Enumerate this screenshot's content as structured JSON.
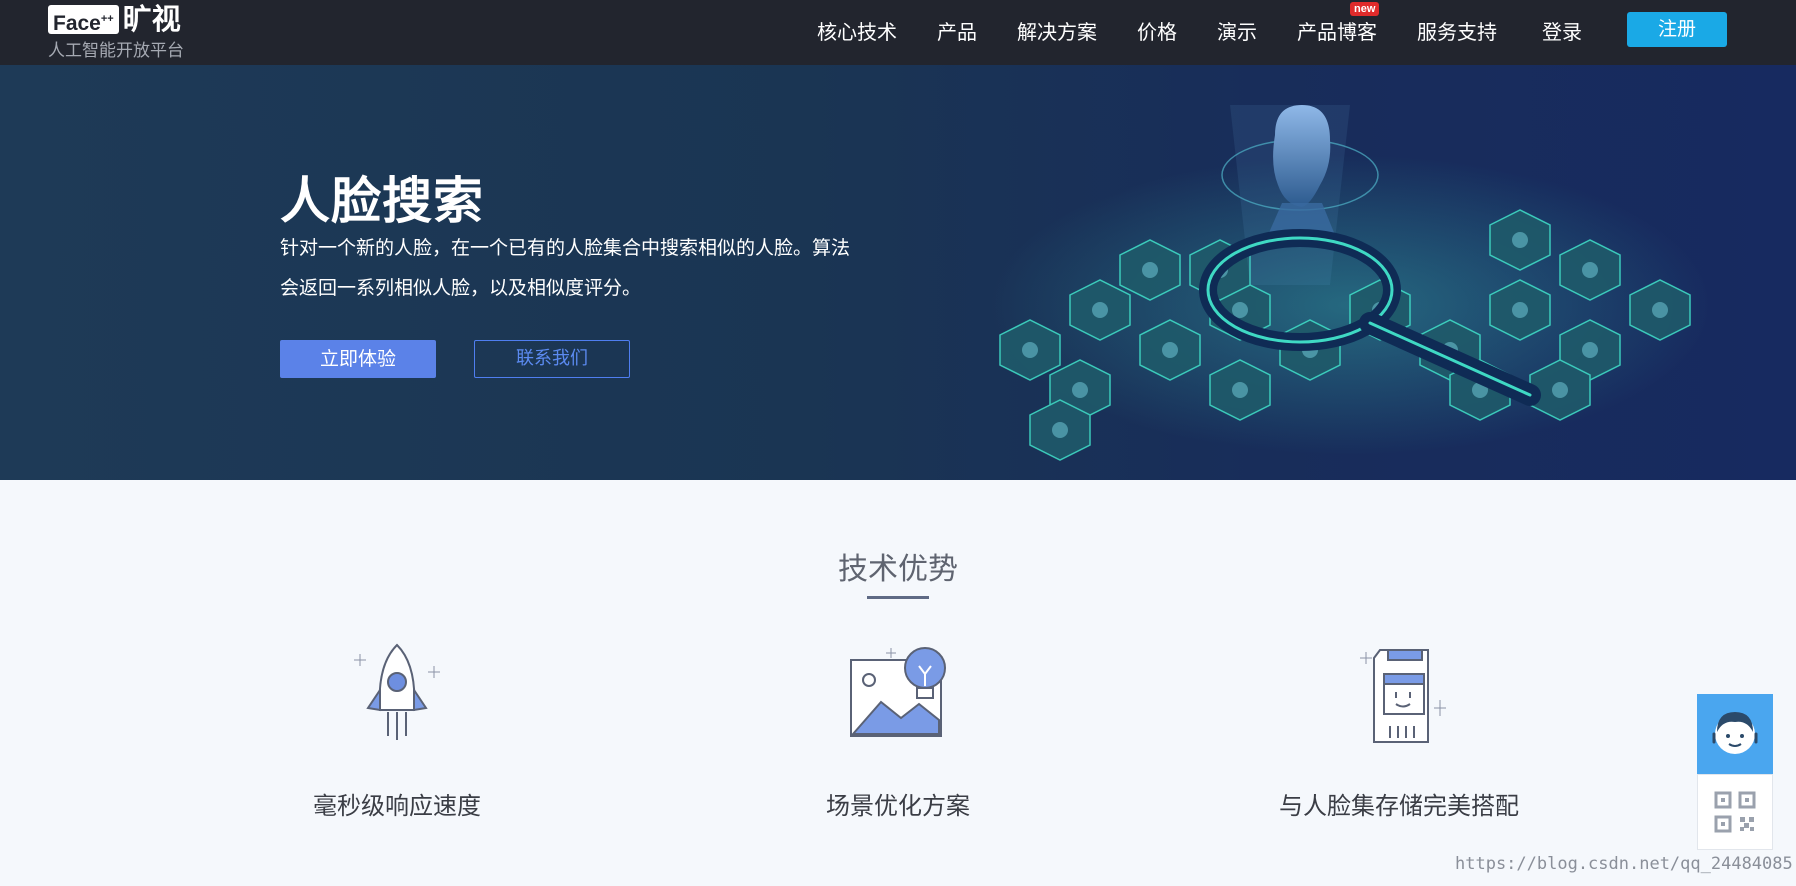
{
  "nav": {
    "logo": {
      "face": "Face",
      "sup": "++",
      "cn": "旷视",
      "subtitle": "人工智能开放平台"
    },
    "items": [
      {
        "label": "核心技术"
      },
      {
        "label": "产品"
      },
      {
        "label": "解决方案"
      },
      {
        "label": "价格"
      },
      {
        "label": "演示"
      },
      {
        "label": "产品博客",
        "badge": "new"
      },
      {
        "label": "服务支持"
      },
      {
        "label": "登录"
      }
    ],
    "register_label": "注册"
  },
  "hero": {
    "title": "人脸搜索",
    "desc_line1": "针对一个新的人脸，在一个已有的人脸集合中搜索相似的人脸。算法",
    "desc_line2": "会返回一系列相似人脸，以及相似度评分。",
    "primary_button": "立即体验",
    "secondary_button": "联系我们"
  },
  "advantages": {
    "title": "技术优势",
    "items": [
      {
        "label": "毫秒级响应速度",
        "icon": "rocket-icon"
      },
      {
        "label": "场景优化方案",
        "icon": "scene-lightbulb-icon"
      },
      {
        "label": "与人脸集存储完美搭配",
        "icon": "storage-card-icon"
      }
    ]
  },
  "floating": {
    "top_icon": "customer-service-icon",
    "bottom_icon": "qr-code-icon"
  },
  "watermark": "https://blog.csdn.net/qq_24484085",
  "colors": {
    "nav_bg": "#22252e",
    "register": "#1aa9e6",
    "primary": "#5b82e8",
    "accent_teal": "#2fd1b8"
  }
}
